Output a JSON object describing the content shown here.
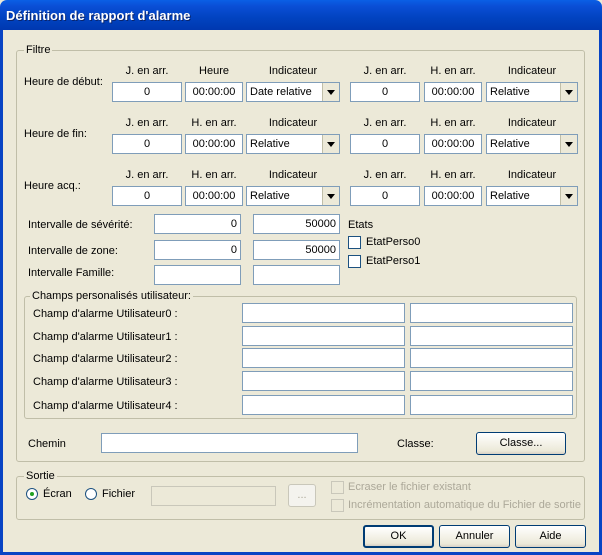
{
  "window": {
    "title": "Définition de rapport d'alarme"
  },
  "filtre": {
    "legend": "Filtre",
    "col_headers_debut": [
      "J. en arr.",
      "Heure",
      "Indicateur",
      "J. en arr.",
      "H. en arr.",
      "Indicateur"
    ],
    "col_headers": [
      "J. en arr.",
      "H. en arr.",
      "Indicateur",
      "J. en arr.",
      "H. en arr.",
      "Indicateur"
    ],
    "rows": [
      {
        "label": "Heure de début:",
        "j1": "0",
        "h1": "00:00:00",
        "ind1": "Date relative",
        "j2": "0",
        "h2": "00:00:00",
        "ind2": "Relative"
      },
      {
        "label": "Heure de fin:",
        "j1": "0",
        "h1": "00:00:00",
        "ind1": "Relative",
        "j2": "0",
        "h2": "00:00:00",
        "ind2": "Relative"
      },
      {
        "label": "Heure acq.:",
        "j1": "0",
        "h1": "00:00:00",
        "ind1": "Relative",
        "j2": "0",
        "h2": "00:00:00",
        "ind2": "Relative"
      }
    ],
    "severite": {
      "label": "Intervalle de sévérité:",
      "min": "0",
      "max": "50000"
    },
    "zone": {
      "label": "Intervalle de zone:",
      "min": "0",
      "max": "50000"
    },
    "famille": {
      "label": "Intervalle Famille:",
      "min": "",
      "max": ""
    },
    "etats": {
      "label": "Etats",
      "items": [
        "EtatPerso0",
        "EtatPerso1"
      ]
    },
    "champs": {
      "legend": "Champs personalisés utilisateur:",
      "rows": [
        {
          "label": "Champ d'alarme Utilisateur0 :",
          "v1": "",
          "v2": ""
        },
        {
          "label": "Champ d'alarme Utilisateur1 :",
          "v1": "",
          "v2": ""
        },
        {
          "label": "Champ d'alarme Utilisateur2 :",
          "v1": "",
          "v2": ""
        },
        {
          "label": "Champ d'alarme Utilisateur3 :",
          "v1": "",
          "v2": ""
        },
        {
          "label": "Champ d'alarme Utilisateur4 :",
          "v1": "",
          "v2": ""
        }
      ]
    },
    "chemin": {
      "label": "Chemin",
      "value": ""
    },
    "classe": {
      "label": "Classe:",
      "button": "Classe..."
    }
  },
  "sortie": {
    "legend": "Sortie",
    "ecran": "Écran",
    "fichier": "Fichier",
    "file_value": "",
    "browse": "...",
    "ecraser": "Ecraser le fichier existant",
    "increment": "Incrémentation automatique du Fichier de sortie"
  },
  "buttons": {
    "ok": "OK",
    "annuler": "Annuler",
    "aide": "Aide"
  }
}
